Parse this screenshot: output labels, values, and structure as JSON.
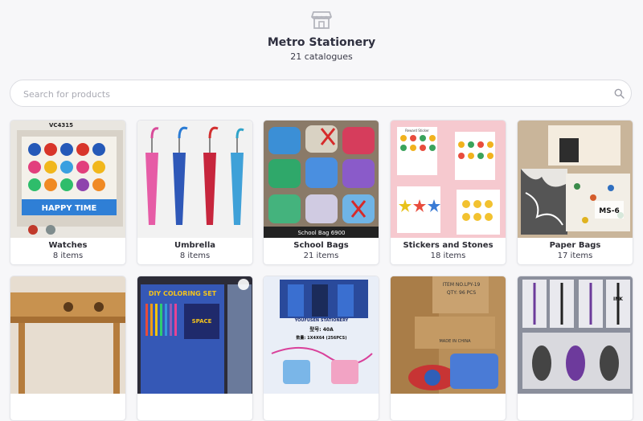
{
  "store": {
    "icon": "storefront-icon",
    "name": "Metro Stationery",
    "catalogue_count": "21 catalogues"
  },
  "search": {
    "placeholder": "Search for products",
    "value": "",
    "icon": "search-icon"
  },
  "catalogues": [
    {
      "title": "Watches",
      "count": "8 items",
      "image_text": "VC4315",
      "image_text_2": "HAPPY TIME"
    },
    {
      "title": "Umbrella",
      "count": "8 items"
    },
    {
      "title": "School Bags",
      "count": "21 items",
      "image_text": "School Bag 6900"
    },
    {
      "title": "Stickers and Stones",
      "count": "18 items",
      "image_text": "Reward Sticker"
    },
    {
      "title": "Paper Bags",
      "count": "17 items",
      "image_text": "MS-6"
    },
    {
      "title": "",
      "count": ""
    },
    {
      "title": "",
      "count": "",
      "image_text": "DIY COLORING SET",
      "image_text_2": "SPACE"
    },
    {
      "title": "",
      "count": "",
      "image_text": "YOUFUSEN STATIONERY",
      "image_text_2": "型号: 40A",
      "image_text_3": "数量: 1X4X64 (256PCS)"
    },
    {
      "title": "",
      "count": "",
      "image_text": "ITEM NO.LPY-19",
      "image_text_2": "QTY: 96 PCS",
      "image_text_3": "MADE IN CHINA"
    },
    {
      "title": "",
      "count": "",
      "image_text": "INK"
    }
  ]
}
